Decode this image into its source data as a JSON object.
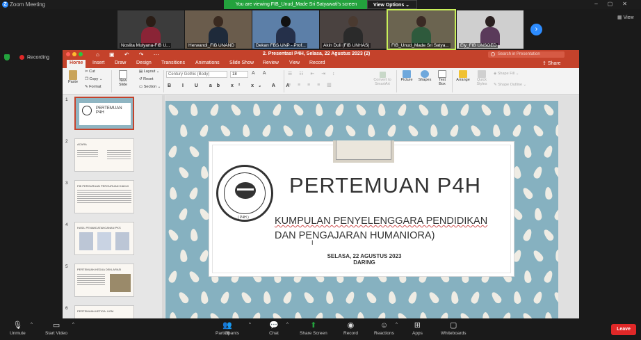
{
  "zoom": {
    "window_title": "Zoom Meeting",
    "viewing_banner": "You are viewing FIB_Unud_Made Sri Satyawati's screen",
    "view_options": "View Options",
    "view_label": "View",
    "recording": "Recording"
  },
  "gallery": [
    {
      "name": "Noslita Mulyana-FIB U..."
    },
    {
      "name": "Herwandi_FIB UNAND"
    },
    {
      "name": "Dekan FBS UNP - Prof..."
    },
    {
      "name": "Akin Duli (FIB UNHAS)"
    },
    {
      "name": "FIB_Unud_Made Sri Satya..."
    },
    {
      "name": "Ely_FIB UNSOED"
    }
  ],
  "ppt": {
    "doc_title": "2. Presentasi P4H, Selasa, 22 Agustus 2023 (2)",
    "search_placeholder": "Search in Presentation",
    "tabs": [
      "Home",
      "Insert",
      "Draw",
      "Design",
      "Transitions",
      "Animations",
      "Slide Show",
      "Review",
      "View",
      "Record"
    ],
    "share": "Share",
    "ribbon": {
      "paste": "Paste",
      "cut": "Cut",
      "copy": "Copy",
      "format": "Format",
      "new_slide": "New Slide",
      "layout": "Layout",
      "reset": "Reset",
      "section": "Section",
      "font": "Century Gothic (Body)",
      "size": "18",
      "convert": "Convert to SmartArt",
      "picture": "Picture",
      "shapes": "Shapes",
      "text_box": "Text Box",
      "arrange": "Arrange",
      "quick_styles": "Quick Styles",
      "shape_fill": "Shape Fill",
      "shape_outline": "Shape Outline"
    },
    "thumbnails": [
      {
        "num": "1",
        "title": "PERTEMUAN P4H"
      },
      {
        "num": "2",
        "title": "ACARA"
      },
      {
        "num": "3",
        "title": "FIB PERGURUAN PERGURUAN DIAKUI"
      },
      {
        "num": "4",
        "title": "HASIL PENANDATANGANAN PKS"
      },
      {
        "num": "5",
        "title": "PERTEMUAN KEDUA DEKLARASI"
      },
      {
        "num": "6",
        "title": "PERTEMUAN KETIGA: UGM"
      }
    ],
    "slide": {
      "title": "PERTEMUAN P4H",
      "subtitle_line1": "KUMPULAN PENYELENGGARA PENDIDIKAN",
      "subtitle_line2": "DAN PENGAJARAN HUMANIORA)",
      "date_line1": "SELASA, 22 AGUSTUS  2023",
      "date_line2": "DARING",
      "seal_label": "( P4H )"
    }
  },
  "toolbar": {
    "unmute": "Unmute",
    "start_video": "Start Video",
    "participants": "Participants",
    "participant_count": "28",
    "chat": "Chat",
    "share_screen": "Share Screen",
    "record": "Record",
    "reactions": "Reactions",
    "apps": "Apps",
    "whiteboards": "Whiteboards",
    "leave": "Leave"
  },
  "colors": {
    "ppt_accent": "#c4422b",
    "zoom_green": "#23a23d",
    "zoom_blue": "#2d8cff",
    "leave_red": "#e02828",
    "slide_bg": "#86b1c0"
  }
}
